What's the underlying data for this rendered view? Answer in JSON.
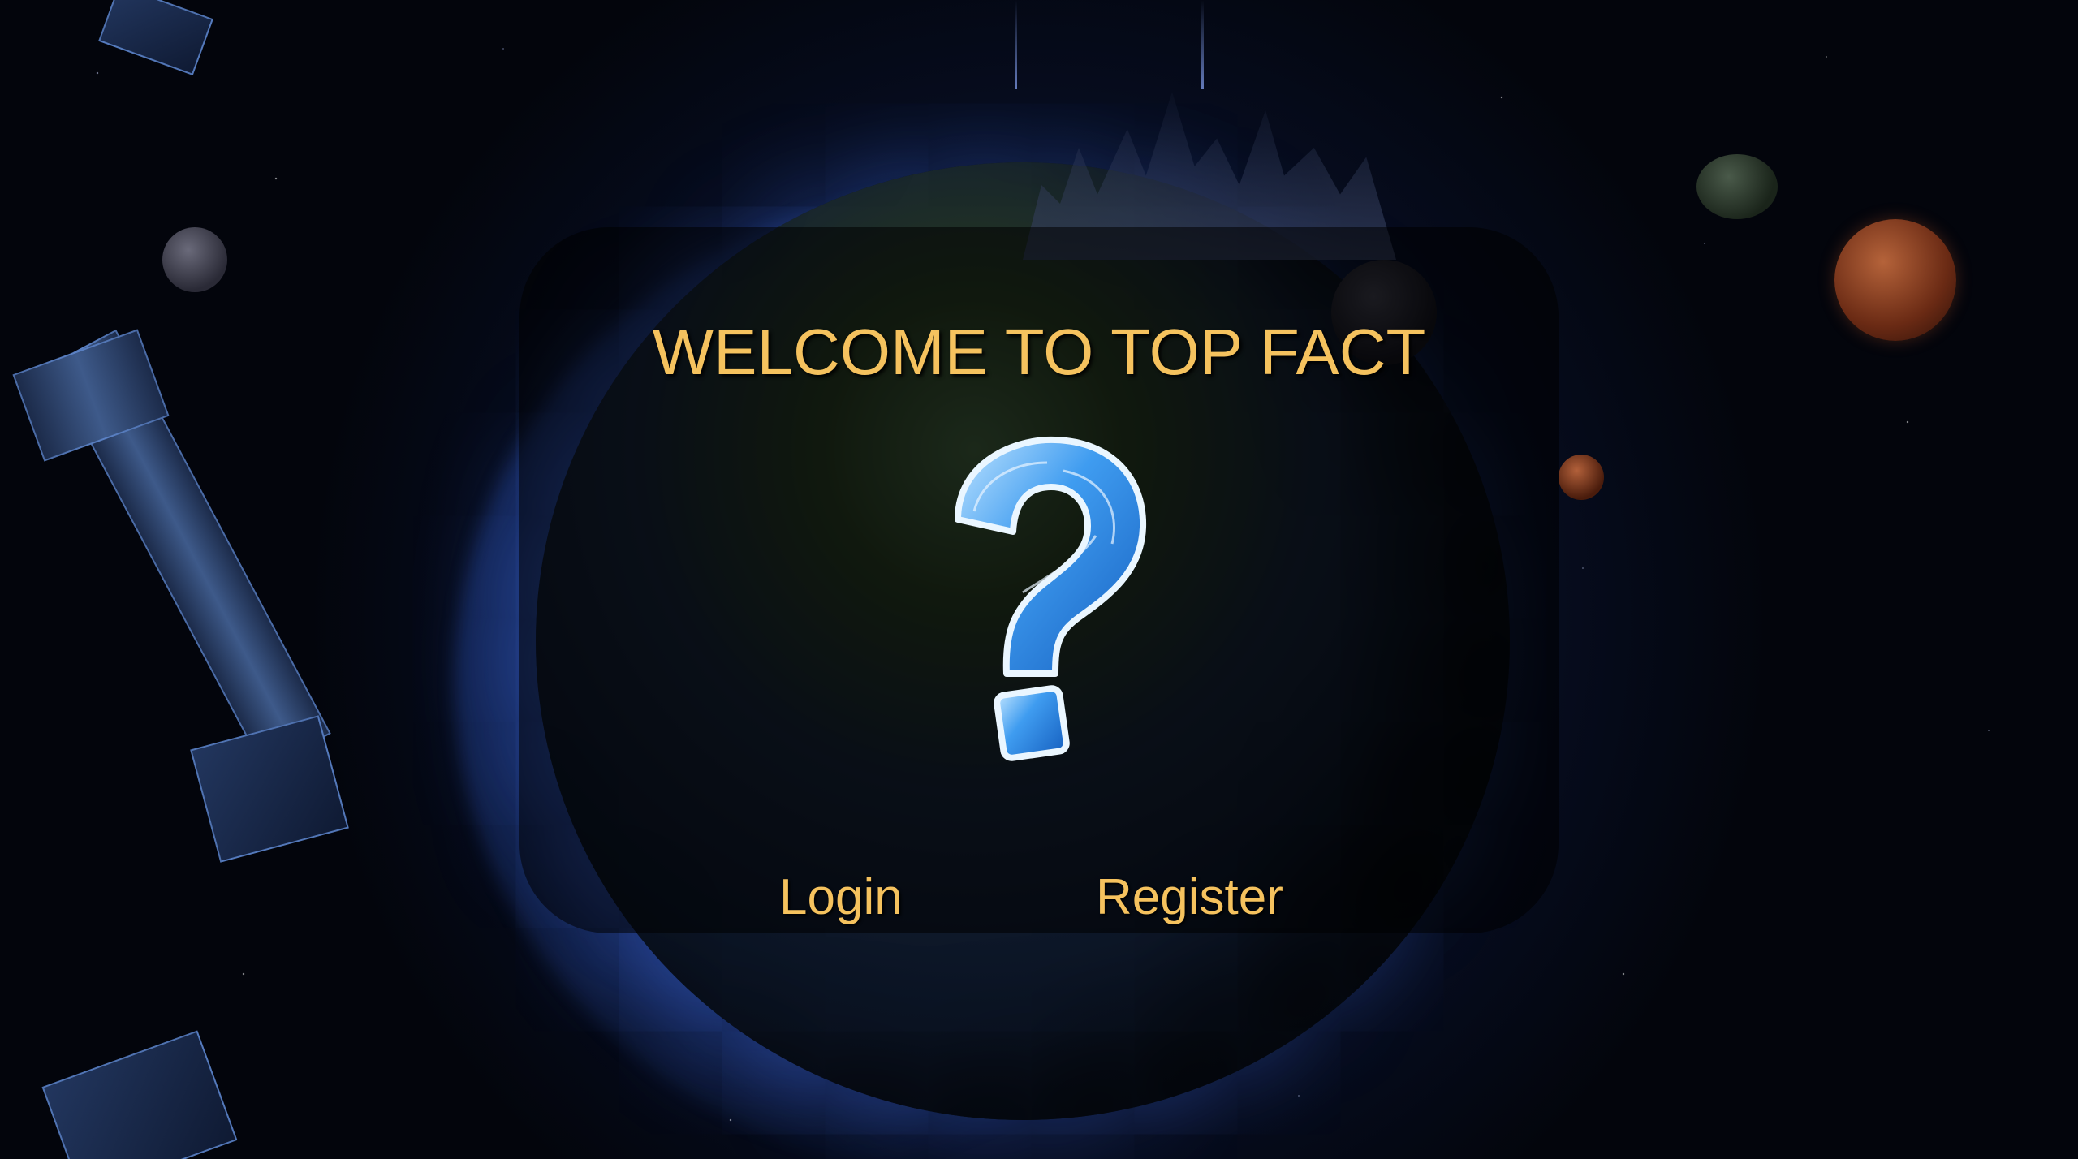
{
  "welcome": {
    "title": "WELCOME TO TOP FACT"
  },
  "actions": {
    "login_label": "Login",
    "register_label": "Register"
  },
  "theme": {
    "accent": "#f5c25e",
    "panel": "rgba(0,0,0,0.55)",
    "icon_blue": "#3f9cf0"
  },
  "icons": {
    "logo": "question-mark-icon"
  }
}
